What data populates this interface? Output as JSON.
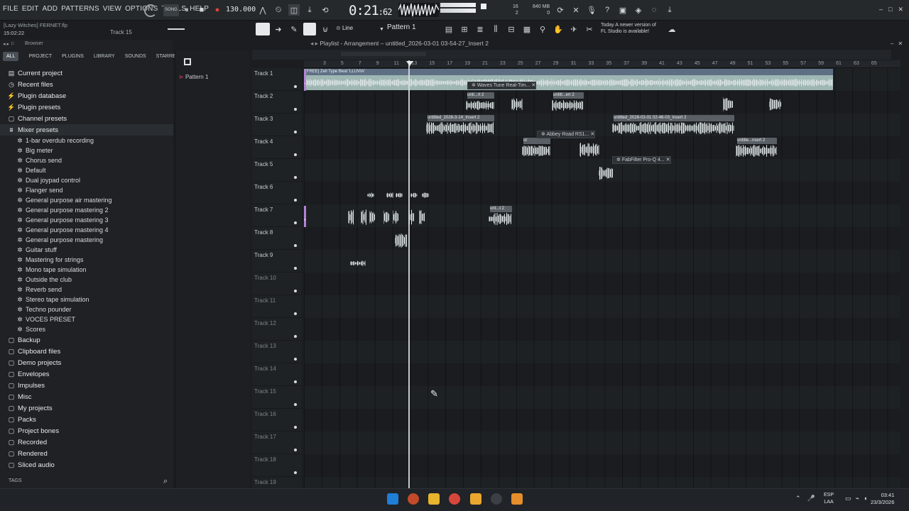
{
  "menu": [
    "FILE",
    "EDIT",
    "ADD",
    "PATTERNS",
    "VIEW",
    "OPTIONS",
    "TOOLS",
    "HELP"
  ],
  "project": {
    "filename": "[Lazy Witches] FERNET.flp",
    "timestamp": "15:02:22",
    "hint": "Track 15"
  },
  "transport": {
    "tempo": "130.000",
    "song_time_main": "0:21",
    "song_time_sub": "62",
    "mode_label": "SONG"
  },
  "monitor": {
    "cpu_label": "16",
    "ram_label": "840 MB",
    "poly": "2",
    "voices": "0"
  },
  "toolbar2": {
    "snap": "Line",
    "pattern": "Pattern 1"
  },
  "news": {
    "line1": "Today  A newer version of",
    "line2": "FL Studio is available!"
  },
  "browser": {
    "header": "Browser",
    "tabs": [
      "ALL",
      "PROJECT",
      "PLUGINS",
      "LIBRARY",
      "SOUNDS",
      "STARRED"
    ],
    "items": [
      {
        "label": "Current project",
        "icon": "document-icon"
      },
      {
        "label": "Recent files",
        "icon": "clock-icon"
      },
      {
        "label": "Plugin database",
        "icon": "plug-icon"
      },
      {
        "label": "Plugin presets",
        "icon": "plug-icon"
      },
      {
        "label": "Channel presets",
        "icon": "folder-icon"
      },
      {
        "label": "Mixer presets",
        "icon": "mixer-icon"
      }
    ],
    "mixer_presets": [
      "1-bar overdub recording",
      "Big meter",
      "Chorus send",
      "Default",
      "Dual joypad control",
      "Flanger send",
      "General purpose air mastering",
      "General purpose mastering 2",
      "General purpose mastering 3",
      "General purpose mastering 4",
      "General purpose mastering",
      "Guitar stuff",
      "Mastering for strings",
      "Mono tape simulation",
      "Outside the club",
      "Reverb send",
      "Stereo tape simulation",
      "Techno pounder",
      "VOCES PRESET"
    ],
    "items_after": [
      {
        "label": "Scores",
        "icon": "gear-icon"
      },
      {
        "label": "Backup",
        "icon": "folder-icon"
      },
      {
        "label": "Clipboard files",
        "icon": "folder-icon"
      },
      {
        "label": "Demo projects",
        "icon": "folder-icon"
      },
      {
        "label": "Envelopes",
        "icon": "folder-icon"
      },
      {
        "label": "Impulses",
        "icon": "folder-icon"
      },
      {
        "label": "Misc",
        "icon": "folder-icon"
      },
      {
        "label": "My projects",
        "icon": "folder-icon"
      },
      {
        "label": "Packs",
        "icon": "folder-icon"
      },
      {
        "label": "Project bones",
        "icon": "folder-icon"
      },
      {
        "label": "Recorded",
        "icon": "folder-icon"
      },
      {
        "label": "Rendered",
        "icon": "folder-icon"
      },
      {
        "label": "Sliced audio",
        "icon": "folder-icon"
      }
    ],
    "tags": "TAGS"
  },
  "patterns": {
    "item": "Pattern 1"
  },
  "playlist": {
    "title": "Playlist - Arrangement – untitled_2026-03-01 03-54-27_Insert 2",
    "ruler": [
      "3",
      "5",
      "7",
      "9",
      "11",
      "13",
      "15",
      "17",
      "19",
      "21",
      "23",
      "25",
      "27",
      "29",
      "31",
      "33",
      "35",
      "37",
      "39",
      "41",
      "43",
      "45",
      "47",
      "49",
      "51",
      "53",
      "55",
      "57",
      "59",
      "61",
      "63",
      "65"
    ],
    "tracks": [
      "Track 1",
      "Track 2",
      "Track 3",
      "Track 4",
      "Track 5",
      "Track 6",
      "Track 7",
      "Track 8",
      "Track 9",
      "Track 10",
      "Track 11",
      "Track 12",
      "Track 13",
      "Track 14",
      "Track 15",
      "Track 16",
      "Track 17",
      "Track 18",
      "Track 19"
    ],
    "clip_titles": {
      "c1": "[FREE] Zell Type Beat 'LLUVIA'",
      "c2": "unti...rt 2",
      "c3": "untitl...ert 2",
      "c4": "untitled_2026-3-14_Insert 2",
      "c5": "untitled_2026-03-01 02-46-03_Insert 2",
      "c6": "ur",
      "c7": "untitle...nsert 2",
      "c8": "unt...t 2"
    },
    "plugins": [
      "Waves Tune Real-Tim...",
      "Abbey Road RS1...",
      "FabFilter Pro-Q 4..."
    ]
  },
  "taskbar": {
    "lang1": "ESP",
    "lang2": "LAA",
    "time": "03:41",
    "date": "23/3/2026"
  }
}
